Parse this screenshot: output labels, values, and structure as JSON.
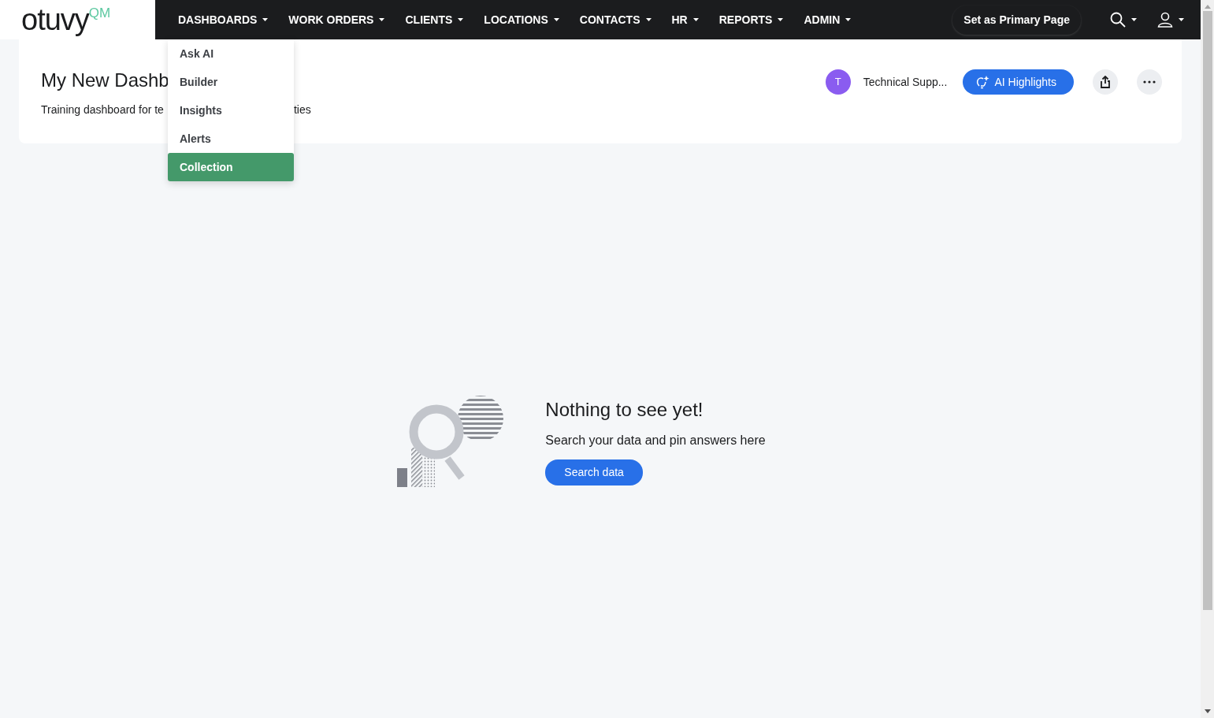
{
  "logo": {
    "text": "otuvy",
    "suffix": "QM"
  },
  "nav": [
    {
      "label": "DASHBOARDS"
    },
    {
      "label": "WORK ORDERS"
    },
    {
      "label": "CLIENTS"
    },
    {
      "label": "LOCATIONS"
    },
    {
      "label": "CONTACTS"
    },
    {
      "label": "HR"
    },
    {
      "label": "REPORTS"
    },
    {
      "label": "ADMIN"
    }
  ],
  "primary_button": "Set as Primary Page",
  "dropdown": [
    {
      "label": "Ask AI",
      "selected": false
    },
    {
      "label": "Builder",
      "selected": false
    },
    {
      "label": "Insights",
      "selected": false
    },
    {
      "label": "Alerts",
      "selected": false
    },
    {
      "label": "Collection",
      "selected": true
    }
  ],
  "dashboard": {
    "title": "My New Dashb",
    "description_start": "Training dashboard for te",
    "description_end": "ties",
    "owner_initial": "T",
    "owner": "Technical Supp...",
    "highlights_button": "AI Highlights"
  },
  "empty_state": {
    "title": "Nothing to see yet!",
    "text": "Search your data and pin answers here",
    "button": "Search data"
  }
}
